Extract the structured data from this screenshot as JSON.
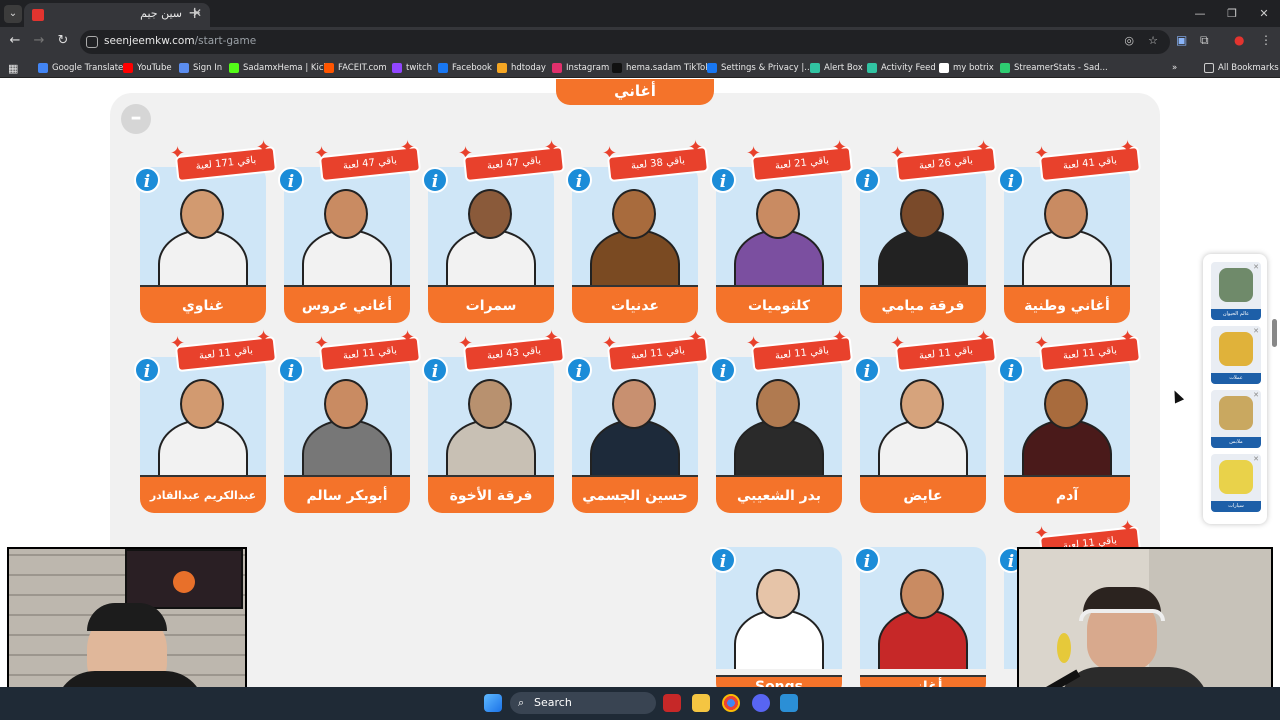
{
  "browser": {
    "tab_title": "سين جيم",
    "url_host": "seenjeemkw.com",
    "url_path": "/start-game",
    "bookmarks": [
      {
        "label": "Google Translate",
        "color": "#4285f4"
      },
      {
        "label": "YouTube",
        "color": "#ff0000"
      },
      {
        "label": "Sign In",
        "color": "#5b8def"
      },
      {
        "label": "SadamxHema | Kick",
        "color": "#53fc18"
      },
      {
        "label": "FACEIT.com",
        "color": "#ff5500"
      },
      {
        "label": "twitch",
        "color": "#9146ff"
      },
      {
        "label": "Facebook",
        "color": "#1877f2"
      },
      {
        "label": "hdtoday",
        "color": "#f5a623"
      },
      {
        "label": "Instagram",
        "color": "#e1306c"
      },
      {
        "label": "hema.sadam TikTok",
        "color": "#111111"
      },
      {
        "label": "Settings & Privacy |...",
        "color": "#1877f2"
      },
      {
        "label": "Alert Box",
        "color": "#31c3a2"
      },
      {
        "label": "Activity Feed",
        "color": "#31c3a2"
      },
      {
        "label": "my botrix",
        "color": "#ffffff"
      },
      {
        "label": "StreamerStats - Sad...",
        "color": "#2ecc71"
      }
    ],
    "all_bookmarks": "All Bookmarks"
  },
  "page": {
    "category_title": "أغاني",
    "cards": [
      {
        "label": "أغاني وطنية",
        "badge": "باقي 41 لعبة",
        "bg": "#cfe6f7"
      },
      {
        "label": "فرقة ميامي",
        "badge": "باقي 26 لعبة",
        "bg": "#cfe6f7"
      },
      {
        "label": "كلثوميات",
        "badge": "باقي 21 لعبة",
        "bg": "#cfe6f7"
      },
      {
        "label": "عدنيات",
        "badge": "باقي 38 لعبة",
        "bg": "#cfe6f7"
      },
      {
        "label": "سمرات",
        "badge": "باقي 47 لعبة",
        "bg": "#cfe6f7"
      },
      {
        "label": "أغاني عروس",
        "badge": "باقي 47 لعبة",
        "bg": "#cfe6f7"
      },
      {
        "label": "غناوي",
        "badge": "باقي 171 لعبة",
        "bg": "#cfe6f7"
      },
      {
        "label": "آدم",
        "badge": "باقي 11 لعبة",
        "bg": "#cfe6f7"
      },
      {
        "label": "عايض",
        "badge": "باقي 11 لعبة",
        "bg": "#cfe6f7"
      },
      {
        "label": "بدر الشعيبي",
        "badge": "باقي 11 لعبة",
        "bg": "#cfe6f7"
      },
      {
        "label": "حسين الجسمي",
        "badge": "باقي 11 لعبة",
        "bg": "#cfe6f7"
      },
      {
        "label": "فرقة الأخوة",
        "badge": "باقي 43 لعبة",
        "bg": "#cfe6f7"
      },
      {
        "label": "أبوبكر سالم",
        "badge": "باقي 11 لعبة",
        "bg": "#cfe6f7"
      },
      {
        "label": "عبدالكريم عبدالقادر",
        "badge": "باقي 11 لعبة",
        "bg": "#cfe6f7"
      },
      {
        "label": "Songs",
        "badge": "",
        "bg": "#cfe6f7"
      },
      {
        "label": "أغاني",
        "badge": "",
        "bg": "#cfe6f7"
      },
      {
        "label": "",
        "badge": "باقي 11 لعبة",
        "bg": "#cfe6f7"
      }
    ],
    "side_ads": [
      {
        "caption": "عالم الحيوان"
      },
      {
        "caption": "عملات"
      },
      {
        "caption": "ملابس"
      },
      {
        "caption": "سيارات"
      }
    ]
  },
  "taskbar": {
    "search_label": "Search"
  },
  "colors": {
    "accent": "#f4732a",
    "badge": "#e8412c",
    "info": "#1b8cd8"
  }
}
